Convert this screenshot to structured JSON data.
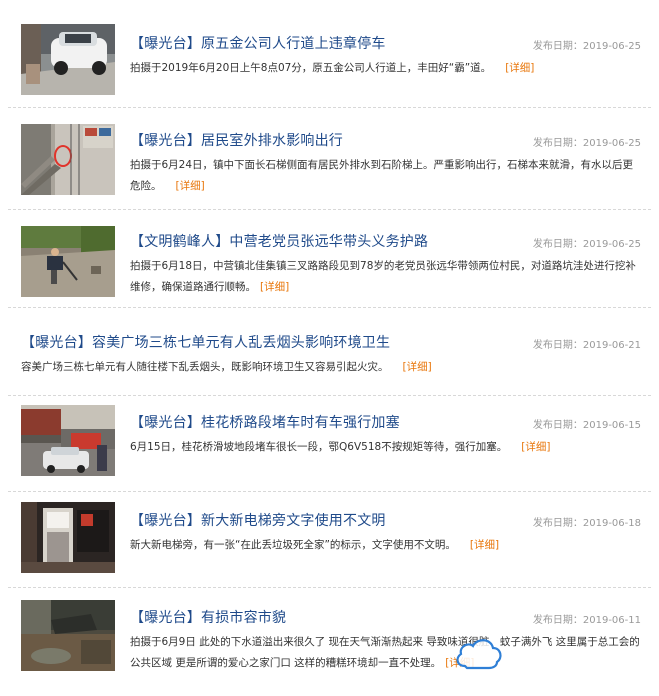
{
  "items": [
    {
      "title": "【曝光台】原五金公司人行道上违章停车",
      "date_label": "发布日期：2019-06-25",
      "summary": "拍摄于2019年6月20日上午8点07分，原五金公司人行道上，丰田好“霸”道。",
      "more": "[详细]",
      "thumb": "car-on-sidewalk"
    },
    {
      "title": "【曝光台】居民室外排水影响出行",
      "date_label": "发布日期：2019-06-25",
      "summary": "拍摄于6月24日，镇中下面长石梯侧面有居民外排水到石阶梯上。严重影响出行，石梯本来就滑，有水以后更危险。",
      "more": "[详细]",
      "thumb": "stone-stairs-drain"
    },
    {
      "title": "【文明鹤峰人】中营老党员张远华带头义务护路",
      "date_label": "发布日期：2019-06-25",
      "summary": "拍摄于6月18日，中营镇北佳集镇三叉路路段见到78岁的老党员张远华带领两位村民，对道路坑洼处进行挖补维修，确保道路通行顺畅。",
      "more": "[详细]",
      "thumb": "road-repair"
    },
    {
      "title": "【曝光台】容美广场三栋七单元有人乱丢烟头影响环境卫生",
      "date_label": "发布日期：2019-06-21",
      "summary": "容美广场三栋七单元有人随往楼下乱丢烟头，既影响环境卫生又容易引起火灾。",
      "more": "[详细]",
      "thumb": ""
    },
    {
      "title": "【曝光台】桂花桥路段堵车时有车强行加塞",
      "date_label": "发布日期：2019-06-15",
      "summary": "6月15日，桂花桥滑坡地段堵车很长一段，鄂Q6V518不按规矩等待，强行加塞。",
      "more": "[详细]",
      "thumb": "traffic-jam"
    },
    {
      "title": "【曝光台】新大新电梯旁文字使用不文明",
      "date_label": "发布日期：2019-06-18",
      "summary": "新大新电梯旁，有一张“在此丢垃圾死全家”的标示，文字使用不文明。",
      "more": "[详细]",
      "thumb": "elevator-sign"
    },
    {
      "title": "【曝光台】有损市容市貌",
      "date_label": "发布日期：2019-06-11",
      "summary": "拍摄于6月9日 此处的下水道溢出来很久了 现在天气渐渐热起来 导致味道很脏、蚊子满外飞 这里属于总工会的公共区域 更是所谓的爱心之家门口 这样的糟糕环境却一直不处理。",
      "more": "[详细]",
      "thumb": "sewer-overflow"
    }
  ]
}
